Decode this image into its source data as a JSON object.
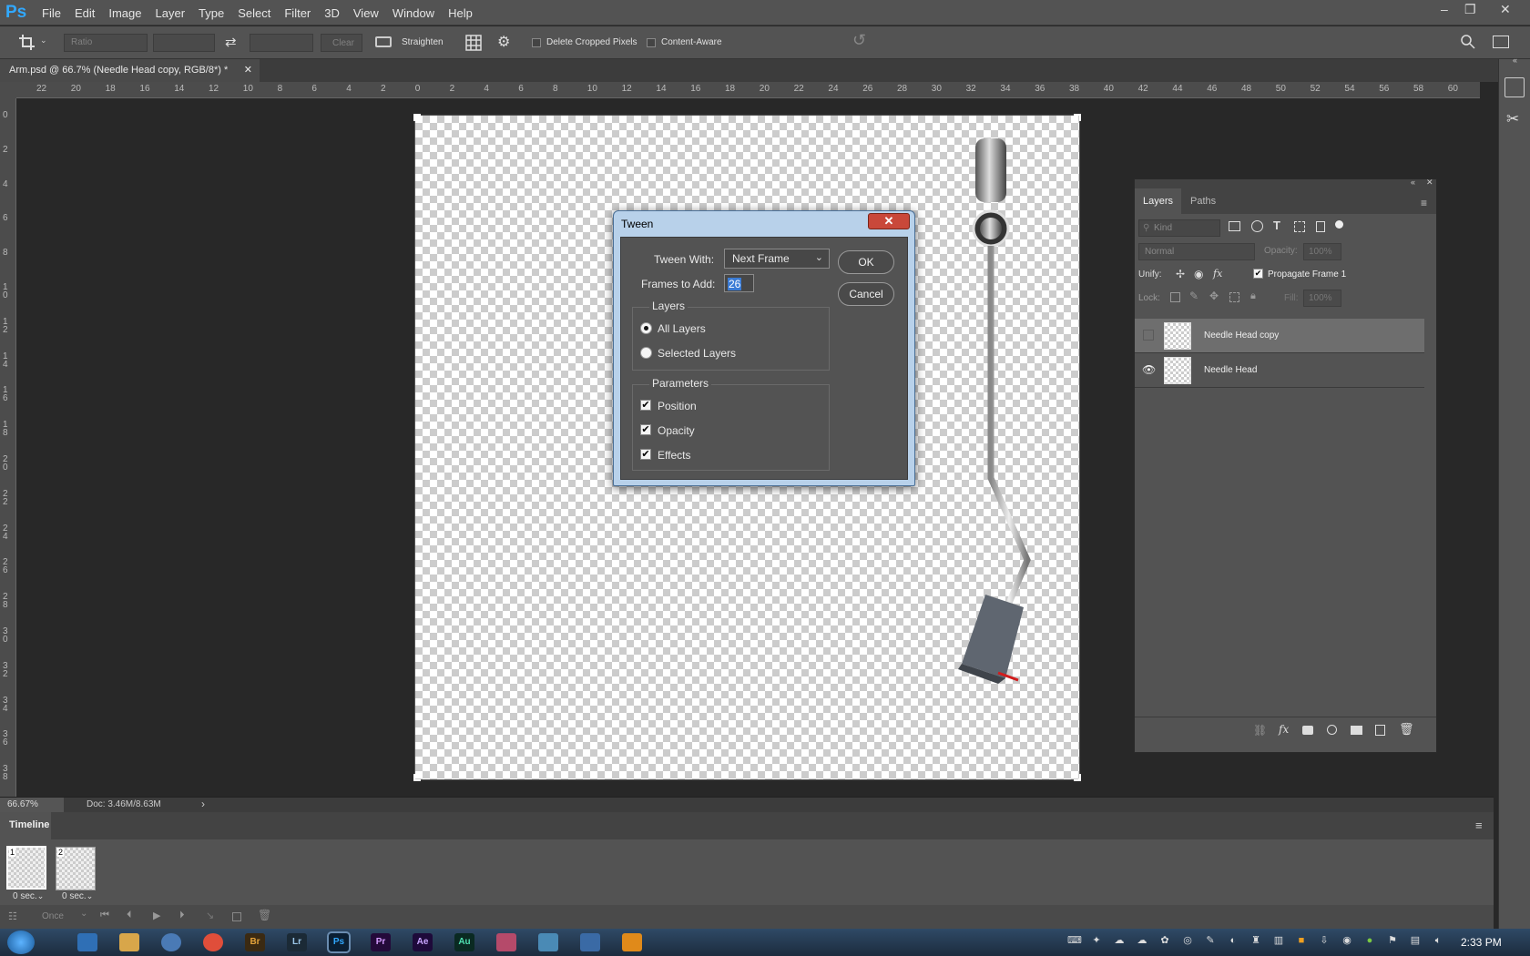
{
  "app": {
    "logo": "Ps"
  },
  "menu": [
    "File",
    "Edit",
    "Image",
    "Layer",
    "Type",
    "Select",
    "Filter",
    "3D",
    "View",
    "Window",
    "Help"
  ],
  "window_controls": {
    "minimize": "–",
    "restore": "❐",
    "close": "✕"
  },
  "options_bar": {
    "ratio_placeholder": "Ratio",
    "clear_label": "Clear",
    "straighten_label": "Straighten",
    "delete_cropped_label": "Delete Cropped Pixels",
    "content_aware_label": "Content-Aware"
  },
  "document_tab": {
    "title": "Arm.psd @ 66.7% (Needle Head copy, RGB/8*) *",
    "close": "✕"
  },
  "ruler_h": [
    "22",
    "20",
    "18",
    "16",
    "14",
    "12",
    "10",
    "8",
    "6",
    "4",
    "2",
    "0",
    "2",
    "4",
    "6",
    "8",
    "10",
    "12",
    "14",
    "16",
    "18",
    "20",
    "22",
    "24",
    "26",
    "28",
    "30",
    "32",
    "34",
    "36",
    "38",
    "40",
    "42",
    "44",
    "46",
    "48",
    "50",
    "52",
    "54",
    "56",
    "58",
    "60"
  ],
  "ruler_v": [
    "0",
    "2",
    "4",
    "6",
    "8",
    "10",
    "12",
    "14",
    "16",
    "18",
    "20",
    "22",
    "24",
    "26",
    "28",
    "30",
    "32",
    "34",
    "36",
    "38"
  ],
  "status": {
    "zoom": "66.67%",
    "doc": "Doc: 3.46M/8.63M",
    "arrow": "›"
  },
  "timeline": {
    "title": "Timeline",
    "frames": [
      {
        "num": "1",
        "delay": "0 sec."
      },
      {
        "num": "2",
        "delay": "0 sec."
      }
    ],
    "loop": "Once"
  },
  "layers_panel": {
    "tabs": [
      "Layers",
      "Paths"
    ],
    "kind": "Kind",
    "blend_mode": "Normal",
    "opacity_label": "Opacity:",
    "opacity_value": "100%",
    "unify_label": "Unify:",
    "propagate_label": "Propagate Frame 1",
    "lock_label": "Lock:",
    "fill_label": "Fill:",
    "fill_value": "100%",
    "layers": [
      {
        "name": "Needle Head copy",
        "visible": false,
        "selected": true
      },
      {
        "name": "Needle Head",
        "visible": true,
        "selected": false
      }
    ]
  },
  "tween_dialog": {
    "title": "Tween",
    "tween_with_label": "Tween With:",
    "tween_with_value": "Next Frame",
    "frames_to_add_label": "Frames to Add:",
    "frames_to_add_value": "26",
    "layers_group": "Layers",
    "all_layers": "All Layers",
    "selected_layers": "Selected Layers",
    "parameters_group": "Parameters",
    "position": "Position",
    "opacity": "Opacity",
    "effects": "Effects",
    "ok": "OK",
    "cancel": "Cancel"
  },
  "taskbar": {
    "apps": [
      "Br",
      "Lr",
      "Ps",
      "Pr",
      "Ae",
      "Au"
    ],
    "clock": "2:33 PM"
  },
  "colors": {
    "accent_blue": "#31a8ff",
    "dialog_frame": "#b8d1ea",
    "close_red": "#c9483a"
  }
}
